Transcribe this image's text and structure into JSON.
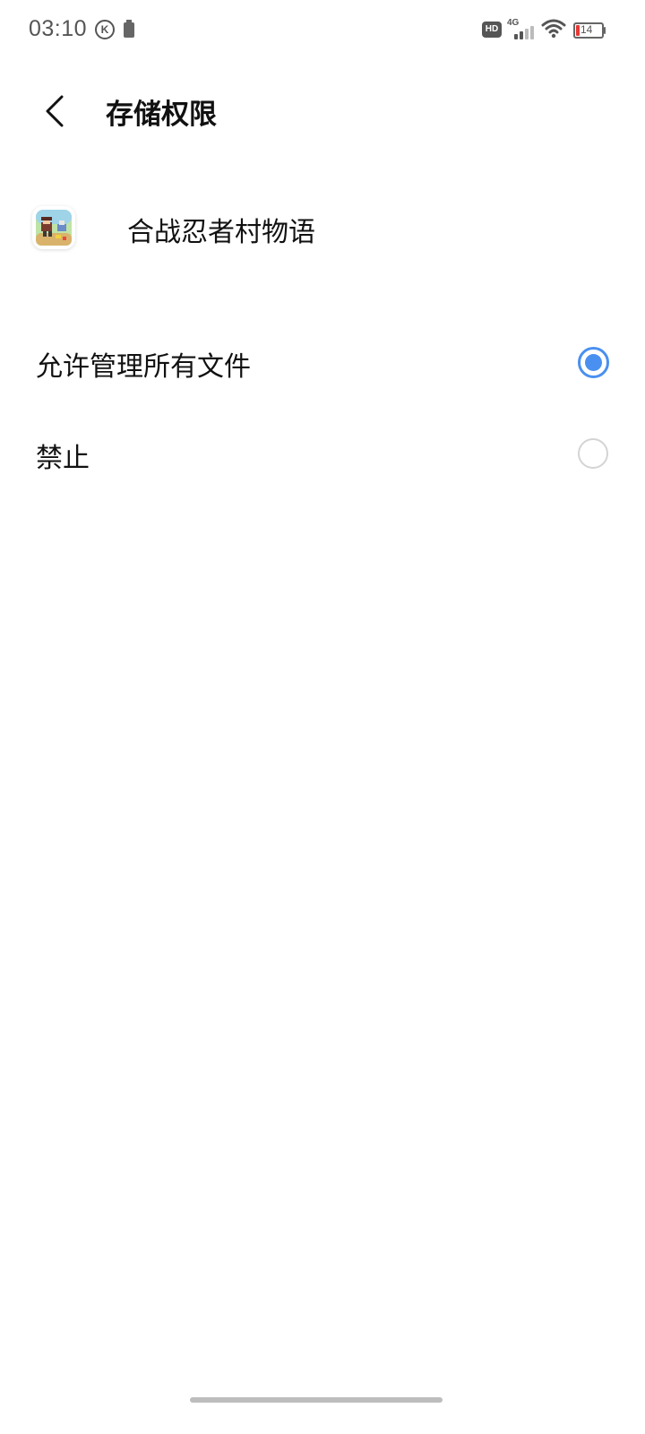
{
  "status_bar": {
    "time": "03:10",
    "k_icon": "K",
    "network_badge": "HD",
    "network_type": "4G",
    "battery_level": "14",
    "icons": [
      "k-circle-icon",
      "battery-saver-icon",
      "hd-icon",
      "signal-4g-icon",
      "wifi-icon",
      "battery-icon"
    ]
  },
  "header": {
    "title": "存储权限",
    "back_icon": "chevron-left-icon"
  },
  "app": {
    "name": "合战忍者村物语",
    "icon": "game-app-icon"
  },
  "options": [
    {
      "label": "允许管理所有文件",
      "selected": true
    },
    {
      "label": "禁止",
      "selected": false
    }
  ],
  "colors": {
    "accent": "#4a90f0",
    "radio_unchecked_border": "#d4d4d4",
    "battery_low": "#e53935"
  }
}
